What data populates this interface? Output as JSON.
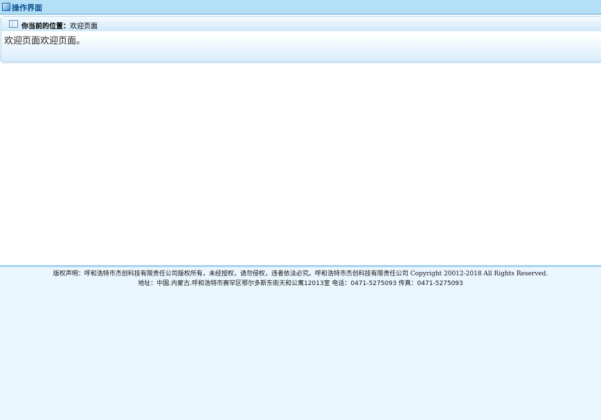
{
  "header": {
    "title": "操作界面",
    "icon": "window-icon"
  },
  "breadcrumb": {
    "label": "你当前的位置：",
    "current": "欢迎页面",
    "icon": "table-icon"
  },
  "main": {
    "text": "欢迎页面欢迎页面。"
  },
  "footer": {
    "copyright_cn": "版权声明：呼和浩特市杰创科技有限责任公司版权所有，未经授权，请勿侵权，违者依法必究。呼和浩特市杰创科技有限责任公司",
    "copyright_en": "Copyright 20012-2018 All Rights Reserved.",
    "address": "地址：中国.内蒙古.呼和浩特市赛罕区鄂尔多斯东街天和公寓12013室 电话：0471-5275093 传真：0471-5275093"
  }
}
